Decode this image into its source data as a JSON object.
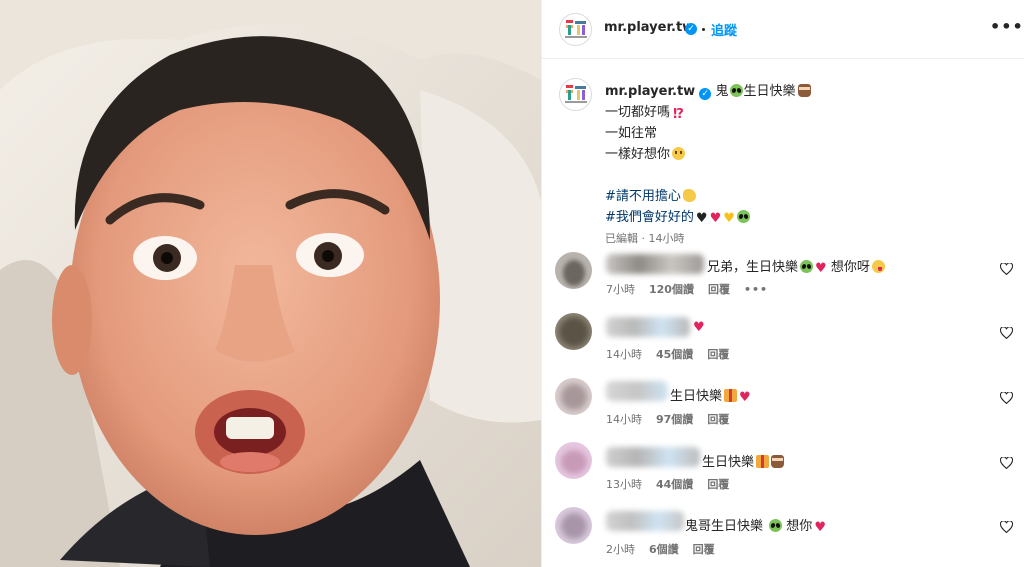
{
  "post": {
    "username": "mr.player.tw",
    "follow_label": "追蹤",
    "caption_lines": [
      "鬼",
      "生日快樂",
      "一切都好嗎",
      "一如往常",
      "一樣好想你"
    ],
    "hashtags": [
      "#請不用擔心",
      "#我們會好好的"
    ],
    "meta": "已編輯 · 14小時"
  },
  "comments": [
    {
      "text": "兄弟，生日快樂",
      "text_tail": "想你呀",
      "time": "7小時",
      "likes": "120個讚",
      "reply": "回覆",
      "more": "•••"
    },
    {
      "text": "",
      "text_tail": "",
      "time": "14小時",
      "likes": "45個讚",
      "reply": "回覆"
    },
    {
      "text": "生日快樂",
      "text_tail": "",
      "time": "14小時",
      "likes": "97個讚",
      "reply": "回覆"
    },
    {
      "text": "生日快樂",
      "text_tail": "",
      "time": "13小時",
      "likes": "44個讚",
      "reply": "回覆"
    },
    {
      "text": "鬼哥生日快樂",
      "text_tail": "想你",
      "time": "2小時",
      "likes": "6個讚",
      "reply": "回覆"
    }
  ],
  "icons": {
    "verified": "verified-badge-icon",
    "more": "more-options-icon",
    "like": "heart-outline-icon",
    "emoji": [
      "alien-emoji",
      "cake-emoji",
      "exclamation-question-emoji",
      "sad-face-emoji",
      "flexed-biceps-emoji",
      "black-heart",
      "red-heart",
      "yellow-heart",
      "gift-emoji",
      "yum-face-emoji"
    ]
  },
  "colors": {
    "link_blue": "#0095f6",
    "hashtag": "#00376b",
    "secondary_text": "#737373",
    "heart_red": "#e0245e"
  }
}
